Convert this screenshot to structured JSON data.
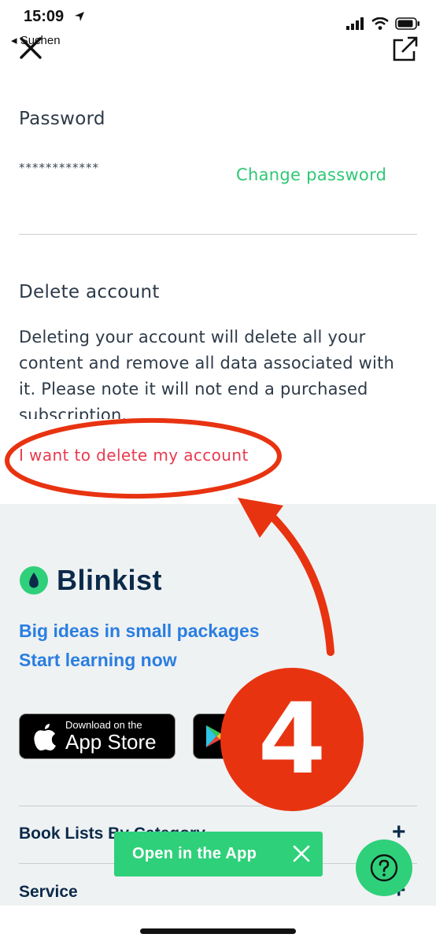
{
  "status_bar": {
    "time": "15:09",
    "back_label": "◂ Suchen"
  },
  "account": {
    "password_title": "Password",
    "password_mask": "************",
    "change_password": "Change password",
    "delete_title": "Delete account",
    "delete_description": "Deleting your account will delete all your content and remove all data associated with it. Please note it will not end a purchased subscription.",
    "delete_link": "I want to delete my account"
  },
  "footer": {
    "brand": "Blinkist",
    "tagline_1": "Big ideas in small packages",
    "tagline_2": "Start learning now",
    "appstore_small": "Download on the",
    "appstore_big": "App Store",
    "accordion": [
      {
        "label": "Book Lists By Category"
      },
      {
        "label": "Service"
      }
    ]
  },
  "banner": {
    "open_in_app": "Open in the App"
  },
  "annotation": {
    "step_number": "4"
  },
  "colors": {
    "accent_green": "#2fd07a",
    "link_green": "#2fc775",
    "delete_red": "#e83a4f",
    "annotation_red": "#e83311",
    "brand_blue": "#2a7ee0",
    "navy": "#0b2a4a"
  }
}
